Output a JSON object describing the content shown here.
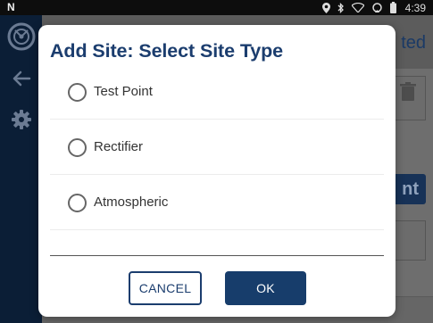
{
  "status_bar": {
    "app_badge": "N",
    "time": "4:39",
    "icons": [
      "location-icon",
      "bluetooth-icon",
      "wifi-icon",
      "sync-icon",
      "battery-icon"
    ]
  },
  "sidebar": {
    "icons": [
      "app-logo-icon",
      "back-arrow-icon",
      "gear-icon"
    ]
  },
  "background": {
    "header_title_fragment": "ted",
    "button_fragment": "nt"
  },
  "dialog": {
    "title": "Add Site: Select Site Type",
    "options": [
      {
        "label": "Test Point",
        "selected": false
      },
      {
        "label": "Rectifier",
        "selected": false
      },
      {
        "label": "Atmospheric",
        "selected": false
      }
    ],
    "cancel_label": "CANCEL",
    "ok_label": "OK"
  },
  "colors": {
    "title": "#1b3d6e",
    "primary_button": "#173d6b",
    "sidebar": "#0b1e36",
    "scrim": "#5a5a5a"
  }
}
